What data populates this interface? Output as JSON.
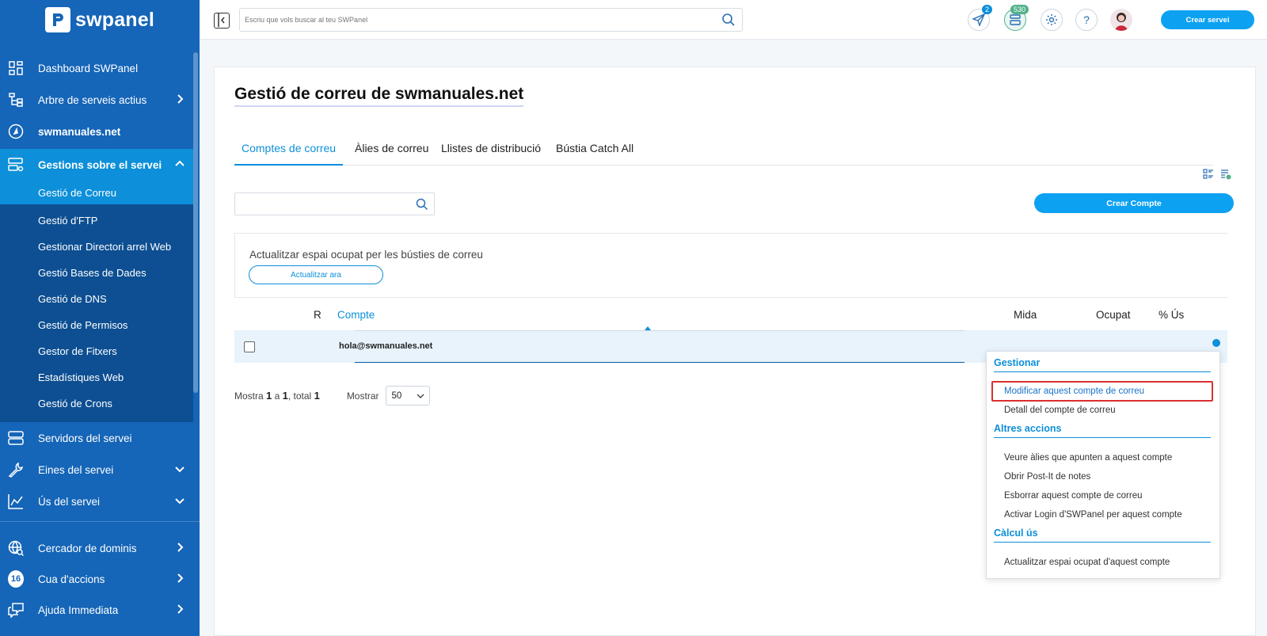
{
  "brand": {
    "name": "swpanel"
  },
  "sidebar": {
    "items": [
      {
        "label": "Dashboard SWPanel",
        "icon": "dashboard-icon"
      },
      {
        "label": "Arbre de serveis actius",
        "icon": "tree-icon"
      },
      {
        "label": "swmanuales.net",
        "icon": "domain-icon"
      },
      {
        "label": "Gestions sobre el servei",
        "icon": "server-settings-icon"
      }
    ],
    "subitems": [
      {
        "label": "Gestió de Correu"
      },
      {
        "label": "Gestió d'FTP"
      },
      {
        "label": "Gestionar Directori arrel Web"
      },
      {
        "label": "Gestió Bases de Dades"
      },
      {
        "label": "Gestió de DNS"
      },
      {
        "label": "Gestió de Permisos"
      },
      {
        "label": "Gestor de Fitxers"
      },
      {
        "label": "Estadístiques Web"
      },
      {
        "label": "Gestió de Crons"
      }
    ],
    "lower_items": [
      {
        "label": "Servidors del servei",
        "icon": "servers-icon"
      },
      {
        "label": "Eines del servei",
        "icon": "wrench-icon"
      },
      {
        "label": "Ús del servei",
        "icon": "chart-icon"
      },
      {
        "label": "Cercador de dominis",
        "icon": "globe-search-icon"
      },
      {
        "label": "Cua d'accions",
        "badge": "16"
      },
      {
        "label": "Ajuda Immediata",
        "icon": "chat-icon"
      }
    ]
  },
  "topbar": {
    "search_placeholder": "Escriu que vols buscar al teu SWPanel",
    "notifications_count": "2",
    "credits_badge": "530",
    "create_service_label": "Crear servei"
  },
  "main": {
    "title": "Gestió de correu de swmanuales.net",
    "tabs": [
      {
        "label": "Comptes de correu"
      },
      {
        "label": "Àlies de correu"
      },
      {
        "label": "Llistes de distribució"
      },
      {
        "label": "Bústia Catch All"
      }
    ],
    "create_account_label": "Crear Compte",
    "update_box": {
      "text": "Actualitzar espai ocupat per les bústies de correu",
      "button": "Actualitzar ara"
    },
    "table": {
      "headers": {
        "r": "R",
        "account": "Compte",
        "size": "Mida",
        "used": "Ocupat",
        "usage": "% Ús"
      },
      "rows": [
        {
          "account": "hola@swmanuales.net"
        }
      ]
    },
    "pagination": {
      "prefix": "Mostra",
      "from": "1",
      "sep": "a",
      "to": "1",
      "total_label": ", total",
      "total": "1",
      "show_label": "Mostrar",
      "page_size": "50"
    }
  },
  "context_menu": {
    "sections": [
      {
        "title": "Gestionar",
        "items": [
          "Modificar aquest compte de correu",
          "Detall del compte de correu"
        ]
      },
      {
        "title": "Altres accions",
        "items": [
          "Veure àlies que apunten a aquest compte",
          "Obrir Post-It de notes",
          "Esborrar aquest compte de correu",
          "Activar Login d'SWPanel per aquest compte"
        ]
      },
      {
        "title": "Càlcul ús",
        "items": [
          "Actualitzar espai ocupat d'aquest compte"
        ]
      }
    ]
  },
  "colors": {
    "sidebar": "#1565b8",
    "accent": "#0da1f2",
    "highlight": "#d93030"
  }
}
